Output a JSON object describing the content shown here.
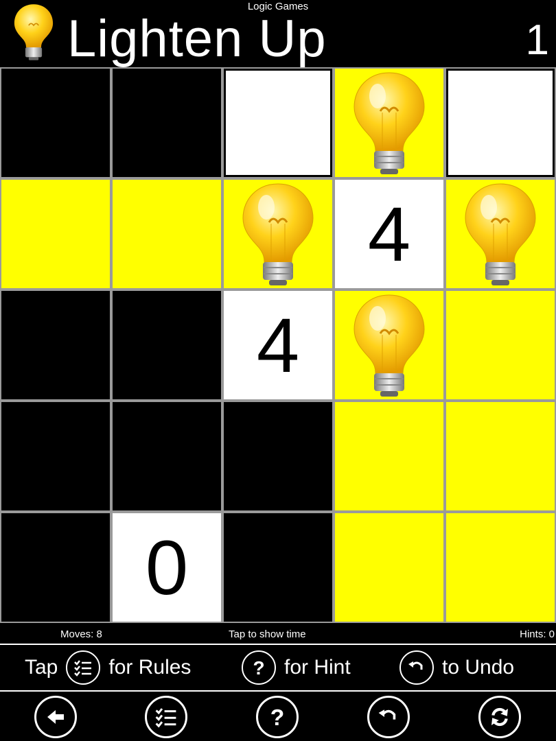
{
  "header": {
    "app_name": "Logic Games",
    "title": "Lighten Up",
    "level": "1"
  },
  "grid": {
    "rows": 5,
    "cols": 5,
    "cells": [
      [
        {
          "type": "black"
        },
        {
          "type": "black"
        },
        {
          "type": "white"
        },
        {
          "type": "lit",
          "bulb": true
        },
        {
          "type": "white"
        }
      ],
      [
        {
          "type": "lit"
        },
        {
          "type": "lit"
        },
        {
          "type": "lit",
          "bulb": true
        },
        {
          "type": "number",
          "value": "4"
        },
        {
          "type": "lit",
          "bulb": true
        }
      ],
      [
        {
          "type": "black"
        },
        {
          "type": "black"
        },
        {
          "type": "number",
          "value": "4"
        },
        {
          "type": "lit",
          "bulb": true
        },
        {
          "type": "lit"
        }
      ],
      [
        {
          "type": "black"
        },
        {
          "type": "black"
        },
        {
          "type": "black"
        },
        {
          "type": "lit"
        },
        {
          "type": "lit"
        }
      ],
      [
        {
          "type": "black"
        },
        {
          "type": "number",
          "value": "0"
        },
        {
          "type": "black"
        },
        {
          "type": "lit"
        },
        {
          "type": "lit"
        }
      ]
    ]
  },
  "status": {
    "moves": "Moves: 8",
    "timer": "Tap to show time",
    "hints": "Hints: 0"
  },
  "help_bar": {
    "tap": "Tap",
    "rules": "for Rules",
    "hint": "for Hint",
    "undo": "to Undo"
  },
  "toolbar": {
    "buttons": [
      "back-icon",
      "rules-list-icon",
      "hint-icon",
      "undo-icon",
      "restart-icon"
    ]
  },
  "colors": {
    "lit": "#ffff00",
    "black": "#000000",
    "white": "#ffffff",
    "gridline": "#9a9a9a"
  }
}
